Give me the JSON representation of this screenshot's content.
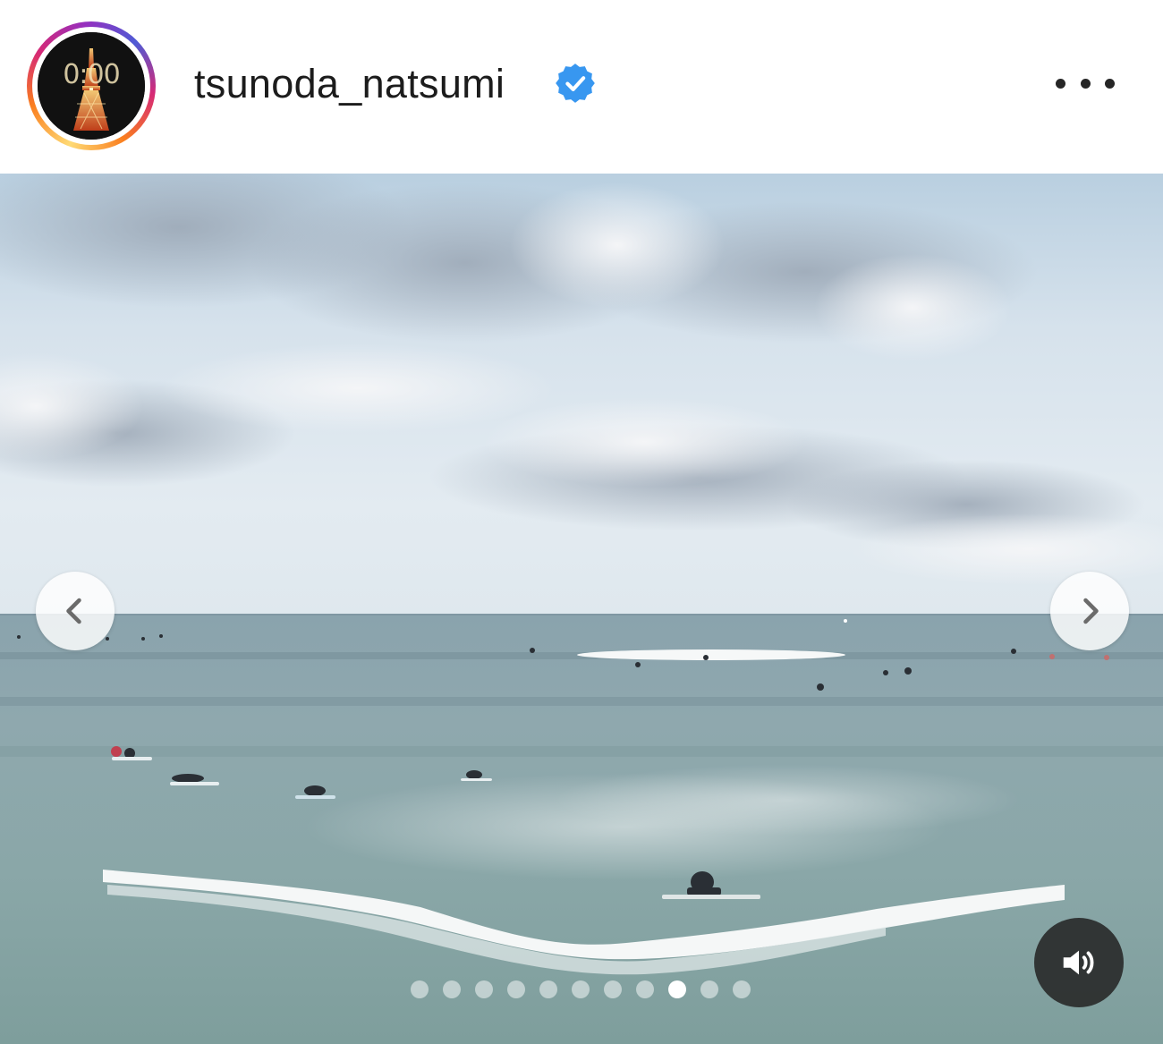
{
  "header": {
    "username": "tsunoda_natsumi",
    "verified": true,
    "avatar_clock_text": "0:00",
    "more_icon": "more-horizontal-icon"
  },
  "media": {
    "type": "video",
    "description_icon_prev": "chevron-left-icon",
    "description_icon_next": "chevron-right-icon",
    "sound_icon": "speaker-on-icon",
    "carousel": {
      "total": 11,
      "active_index": 8
    }
  },
  "colors": {
    "verified_badge": "#3897f0",
    "text": "#1c1c1c",
    "sound_button_bg": "#262626"
  }
}
